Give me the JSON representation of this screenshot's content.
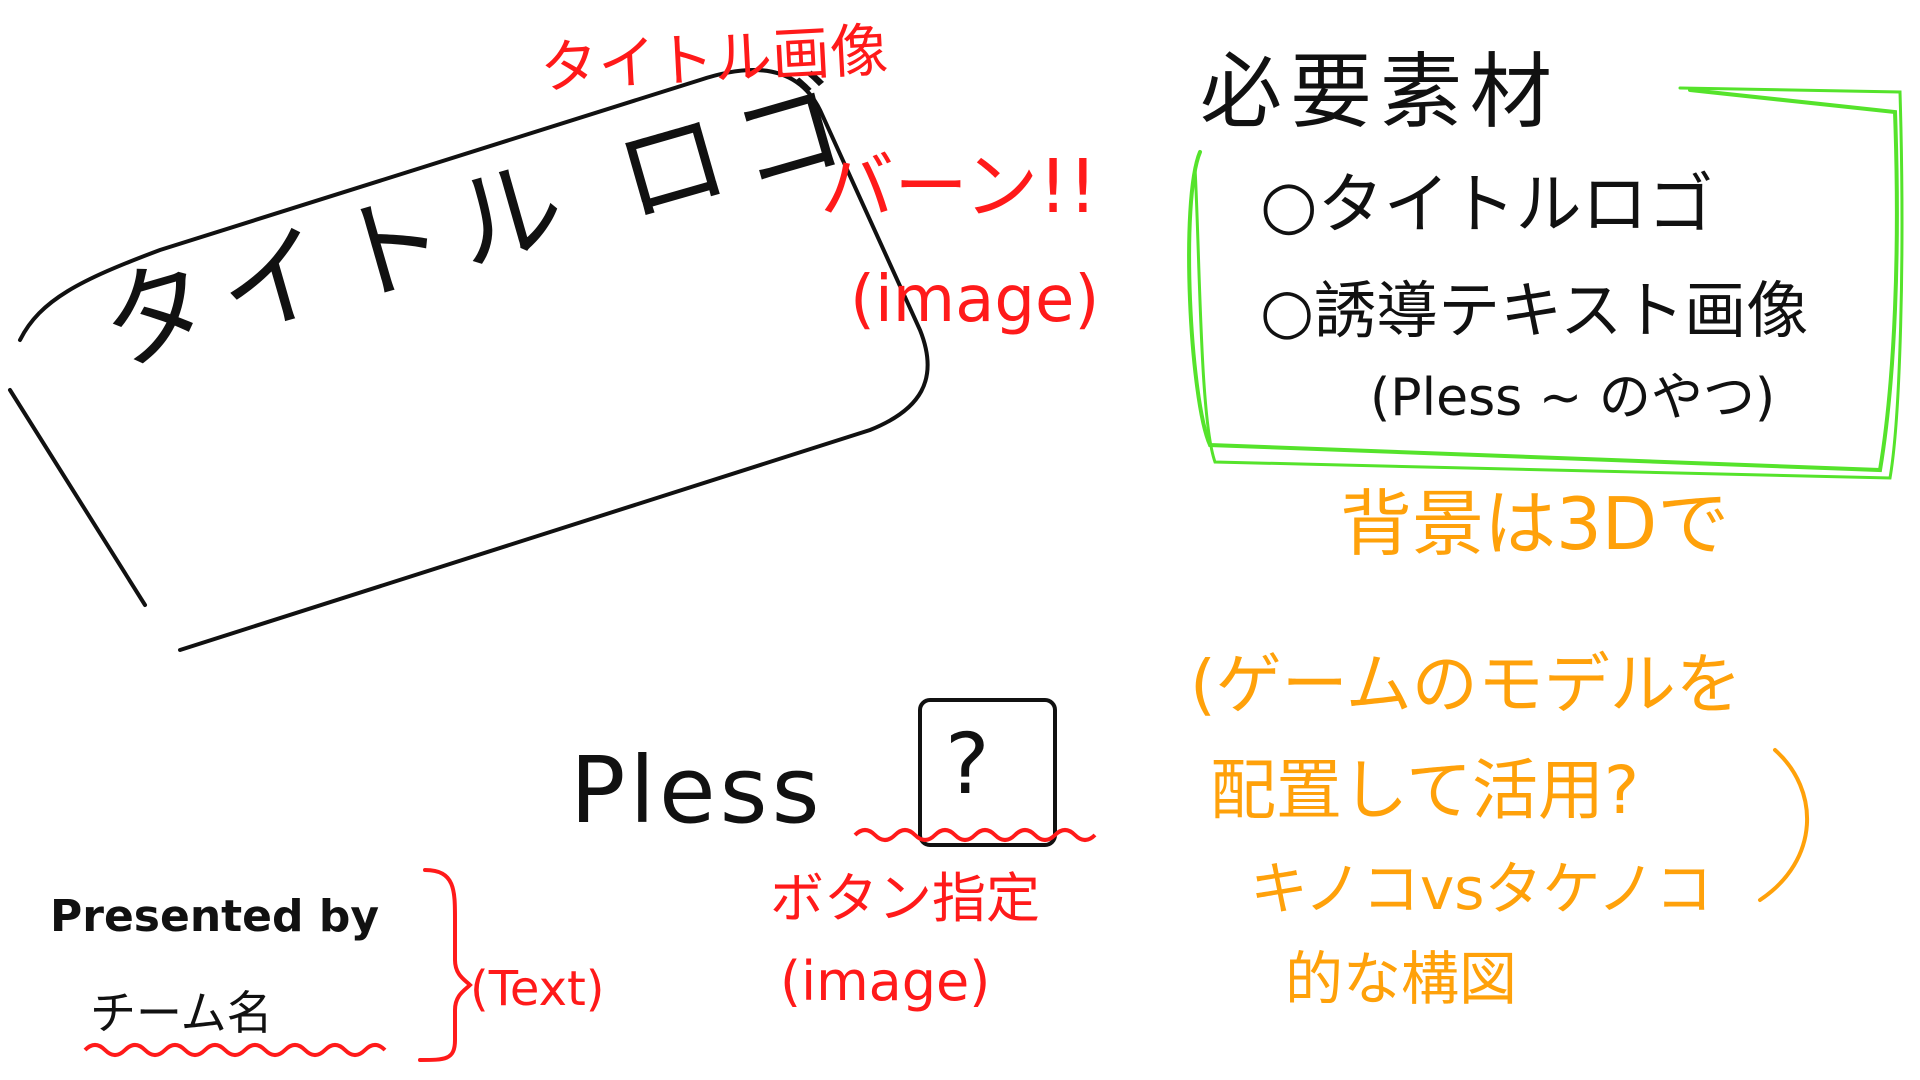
{
  "title_logo": {
    "text": "タイトル ロゴ"
  },
  "title_note": {
    "line1": "タイトル画像",
    "line2": "バーン!!",
    "line3": "(image)"
  },
  "materials": {
    "heading": "必要素材",
    "items": [
      "○タイトルロゴ",
      "○誘導テキスト画像",
      "(Pless ~ のやつ)"
    ]
  },
  "press_prompt": {
    "text": "Pless",
    "button_label": "?"
  },
  "button_note": {
    "line1": "ボタン指定",
    "line2": "(image)"
  },
  "credit": {
    "line1": "Presented by",
    "line2": "チーム名",
    "note": "(Text)"
  },
  "background_note": {
    "lines": [
      "背景は3Dで",
      "(ゲームのモデルを",
      "配置して活用?",
      "キノコvsタケノコ",
      "的な構図"
    ]
  },
  "colors": {
    "ink": "#111111",
    "annotation_red": "#ff1a1a",
    "materials_green": "#55e32b",
    "background_note_orange": "#ffa10a"
  }
}
